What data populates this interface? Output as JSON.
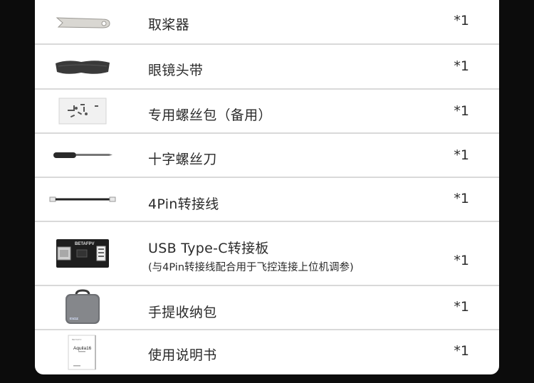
{
  "items": [
    {
      "name": "取桨器",
      "qty": "*1",
      "icon": "prop-remover-icon"
    },
    {
      "name": "眼镜头带",
      "qty": "*1",
      "icon": "goggle-strap-icon"
    },
    {
      "name": "专用螺丝包（备用）",
      "qty": "*1",
      "icon": "screw-pack-icon"
    },
    {
      "name": "十字螺丝刀",
      "qty": "*1",
      "icon": "screwdriver-icon"
    },
    {
      "name": "4Pin转接线",
      "qty": "*1",
      "icon": "cable-icon"
    },
    {
      "name": "USB Type-C转接板",
      "sub": "(与4Pin转接线配合用于飞控连接上位机调参)",
      "qty": "*1",
      "icon": "adapter-board-icon",
      "icon_text": "BETAFPV"
    },
    {
      "name": "手提收纳包",
      "qty": "*1",
      "icon": "carry-case-icon",
      "icon_text": "BETAFPV"
    },
    {
      "name": "使用说明书",
      "qty": "*1",
      "icon": "manual-icon",
      "icon_text": "Aquila16",
      "icon_brand": "BETAFPV"
    }
  ]
}
